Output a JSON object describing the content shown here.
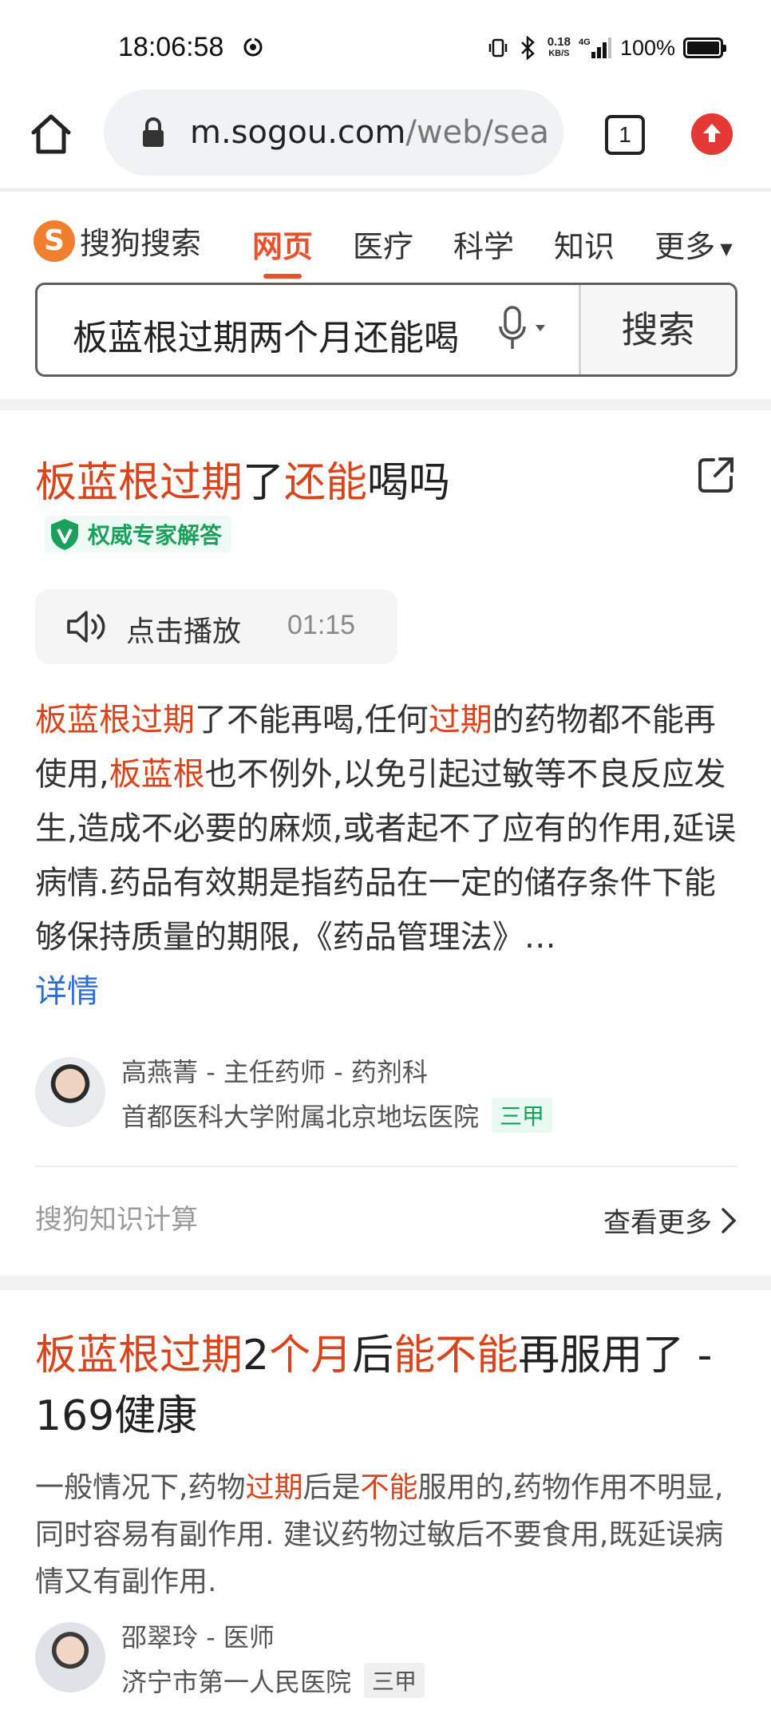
{
  "status_bar": {
    "time": "18:06:58",
    "net_speed_value": "0.18",
    "net_speed_unit": "KB/S",
    "network_type": "4G",
    "battery": "100%"
  },
  "browser": {
    "url_domain": "m.sogou.com",
    "url_rest": "/web/sea",
    "tab_count": "1"
  },
  "sogou": {
    "logo_text": "搜狗搜索",
    "tabs": [
      {
        "label": "网页",
        "active": true
      },
      {
        "label": "医疗"
      },
      {
        "label": "科学"
      },
      {
        "label": "知识"
      },
      {
        "label": "更多"
      }
    ],
    "query": "板蓝根过期两个月还能喝",
    "search_button": "搜索"
  },
  "result1": {
    "title_parts": [
      "板蓝根过期",
      "了",
      "还能",
      "喝吗"
    ],
    "badge": "权威专家解答",
    "play_label": "点击播放",
    "duration": "01:15",
    "snippet_parts": [
      "板蓝根过期",
      "了不能再喝,任何",
      "过期",
      "的药物都不能再使用,",
      "板蓝根",
      "也不例外,以免引起过敏等不良反应发生,造成不必要的麻烦,或者起不了应有的作用,延误病情.药品有效期是指药品在一定的储存条件下能够保持质量的期限,《药品管理法》…"
    ],
    "detail_link": "详情",
    "author_name": "高燕菁",
    "author_title": "主任药师",
    "author_dept": "药剂科",
    "author_sep": " - ",
    "hospital": "首都医科大学附属北京地坛医院",
    "hospital_tag": "三甲",
    "source": "搜狗知识计算",
    "more": "查看更多"
  },
  "result2": {
    "title_parts": [
      "板蓝根过期",
      "2",
      "个月",
      "后",
      "能不能",
      "再服用了 - 169健康"
    ],
    "snippet_parts": [
      "一般情况下,药物",
      "过期",
      "后是",
      "不能",
      "服用的,药物作用不明显,同时容易有副作用. 建议药物过敏后不要食用,既延误病情又有副作用."
    ],
    "author_name": "邵翠玲",
    "author_title": "医师",
    "author_sep": " - ",
    "hospital": "济宁市第一人民医院",
    "hospital_tag": "三甲"
  },
  "colors": {
    "highlight": "#d8441b",
    "brand_orange": "#e5532d",
    "link_blue": "#2c6ed4",
    "badge_green": "#1aa05c"
  }
}
